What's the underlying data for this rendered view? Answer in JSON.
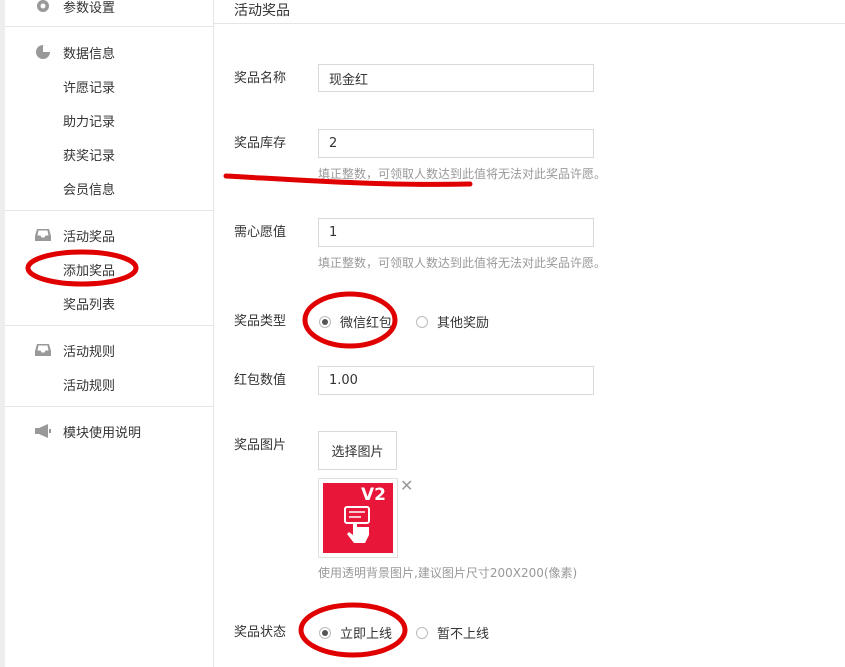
{
  "sidebar": {
    "top_partial": "参数设置",
    "data_section": {
      "title": "数据信息",
      "items": [
        "许愿记录",
        "助力记录",
        "获奖记录",
        "会员信息"
      ]
    },
    "prize_section": {
      "title": "活动奖品",
      "items": [
        "添加奖品",
        "奖品列表"
      ]
    },
    "rules_section": {
      "title": "活动规则",
      "items": [
        "活动规则"
      ]
    },
    "help_item": "模块使用说明"
  },
  "header": {
    "title": "活动奖品"
  },
  "form": {
    "prize_name": {
      "label": "奖品名称",
      "value": "现金红"
    },
    "prize_stock": {
      "label": "奖品库存",
      "value": "2",
      "help": "填正整数，可领取人数达到此值将无法对此奖品许愿。"
    },
    "wish_value": {
      "label": "需心愿值",
      "value": "1",
      "help": "填正整数，可领取人数达到此值将无法对此奖品许愿。"
    },
    "prize_type": {
      "label": "奖品类型",
      "options": [
        "微信红包",
        "其他奖励"
      ],
      "selected": "微信红包"
    },
    "red_packet_value": {
      "label": "红包数值",
      "value": "1.00"
    },
    "prize_image": {
      "label": "奖品图片",
      "button": "选择图片",
      "thumb_text": "V2",
      "help": "使用透明背景图片,建议图片尺寸200X200(像素)"
    },
    "prize_status": {
      "label": "奖品状态",
      "options": [
        "立即上线",
        "暂不上线"
      ],
      "selected": "立即上线"
    }
  },
  "colors": {
    "annotation_red": "#e00000",
    "thumb_red": "#e8173a",
    "help_gray": "#999999"
  }
}
